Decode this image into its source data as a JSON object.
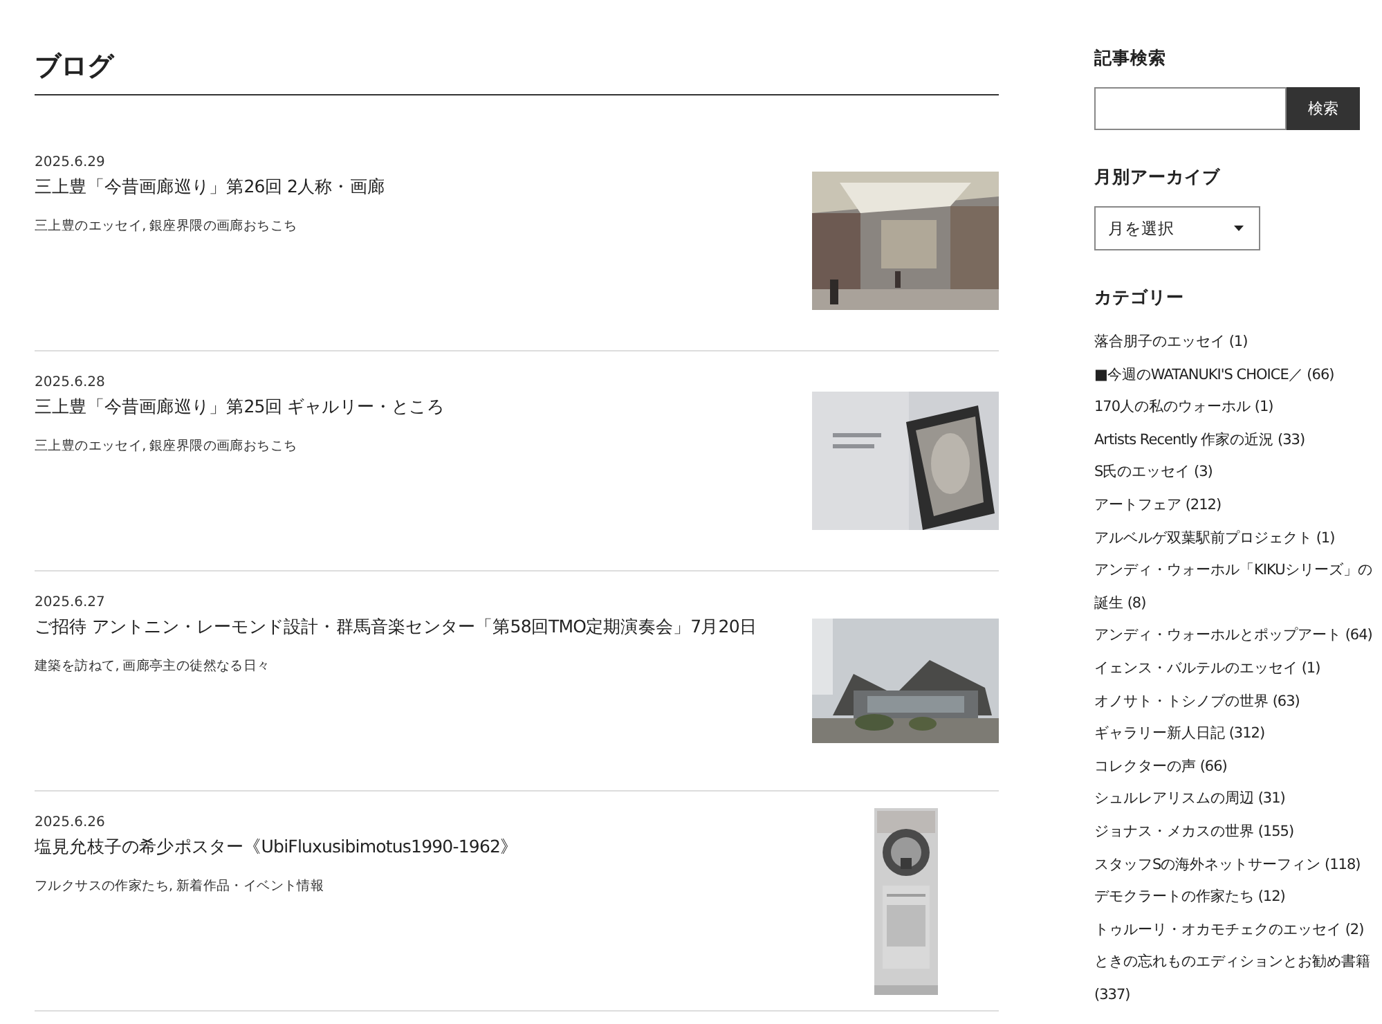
{
  "page_title": "ブログ",
  "posts": [
    {
      "date": "2025.6.29",
      "title": "三上豊「今昔画廊巡り」第26回 2人称・画廊",
      "categories": "三上豊のエッセイ, 銀座界隈の画廊おちこち"
    },
    {
      "date": "2025.6.28",
      "title": "三上豊「今昔画廊巡り」第25回 ギャルリー・ところ",
      "categories": "三上豊のエッセイ, 銀座界隈の画廊おちこち"
    },
    {
      "date": "2025.6.27",
      "title": "ご招待 アントニン・レーモンド設計・群馬音楽センター「第58回TMO定期演奏会」7月20日",
      "categories": "建築を訪ねて, 画廊亭主の徒然なる日々"
    },
    {
      "date": "2025.6.26",
      "title": "塩見允枝子の希少ポスター《UbiFluxusibimotus1990-1962》",
      "categories": "フルクサスの作家たち, 新着作品・イベント情報"
    }
  ],
  "sidebar": {
    "search": {
      "heading": "記事検索",
      "button": "検索"
    },
    "archive": {
      "heading": "月別アーカイブ",
      "select": "月を選択"
    },
    "categories": {
      "heading": "カテゴリー",
      "items": [
        "落合朋子のエッセイ (1)",
        "■今週のWATANUKI'S CHOICE／ (66)",
        "170人の私のウォーホル (1)",
        "Artists Recently 作家の近況 (33)",
        "S氏のエッセイ (3)",
        "アートフェア (212)",
        "アルベルゲ双葉駅前プロジェクト (1)",
        "アンディ・ウォーホル「KIKUシリーズ」の誕生 (8)",
        "アンディ・ウォーホルとポップアート (64)",
        "イェンス・バルテルのエッセイ (1)",
        "オノサト・トシノブの世界 (63)",
        "ギャラリー新人日記 (312)",
        "コレクターの声 (66)",
        "シュルレアリスムの周辺 (31)",
        "ジョナス・メカスの世界 (155)",
        "スタッフSの海外ネットサーフィン (118)",
        "デモクラートの作家たち (12)",
        "トゥルーリ・オカモチェクのエッセイ (2)",
        "ときの忘れものエディションとお勧め書籍 (337)"
      ]
    }
  }
}
